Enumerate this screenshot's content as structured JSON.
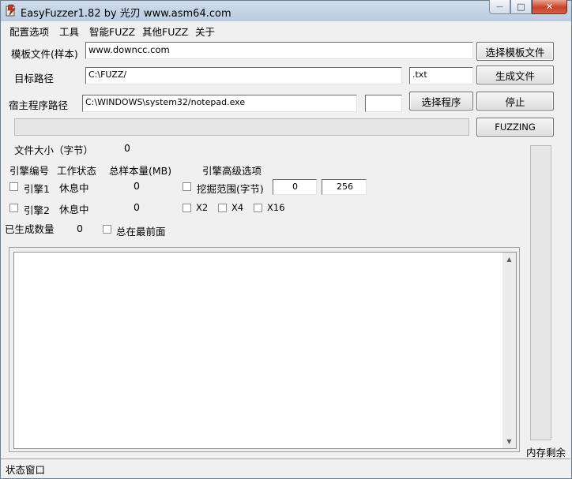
{
  "window": {
    "title": "EasyFuzzer1.82  by 光刃 www.asm64.com",
    "minimize_glyph": "—",
    "maximize_glyph": "□",
    "close_glyph": "✕"
  },
  "menu": {
    "items": [
      "配置选项",
      "工具",
      "智能FUZZ",
      "其他FUZZ",
      "关于"
    ]
  },
  "form": {
    "template_label": "模板文件(样本)",
    "template_value": "www.downcc.com",
    "target_label": "目标路径",
    "target_value": "C:\\FUZZ/",
    "ext_value": ".txt",
    "host_label": "宿主程序路径",
    "host_value": "C:\\WINDOWS\\system32/notepad.exe",
    "host_extra_value": ""
  },
  "buttons": {
    "select_template": "选择模板文件",
    "generate_files": "生成文件",
    "select_program": "选择程序",
    "stop": "停止",
    "fuzzing": "FUZZING"
  },
  "info": {
    "file_size_label": "文件大小（字节）",
    "file_size_value": "0",
    "engine_no_header": "引擎编号",
    "work_status_header": "工作状态",
    "total_samples_header": "总样本量(MB)",
    "advanced_header": "引擎高级选项"
  },
  "engines": [
    {
      "label": "引擎1",
      "status": "休息中",
      "samples": "0"
    },
    {
      "label": "引擎2",
      "status": "休息中",
      "samples": "0"
    }
  ],
  "advanced": {
    "range_label": "挖掘范围(字节)",
    "range_from": "0",
    "range_to": "256",
    "x2": "X2",
    "x4": "X4",
    "x16": "X16"
  },
  "generated": {
    "label": "已生成数量",
    "value": "0",
    "always_on_top": "总在最前面"
  },
  "memory_label": "内存剩余",
  "status_bar": {
    "text": "状态窗口"
  }
}
